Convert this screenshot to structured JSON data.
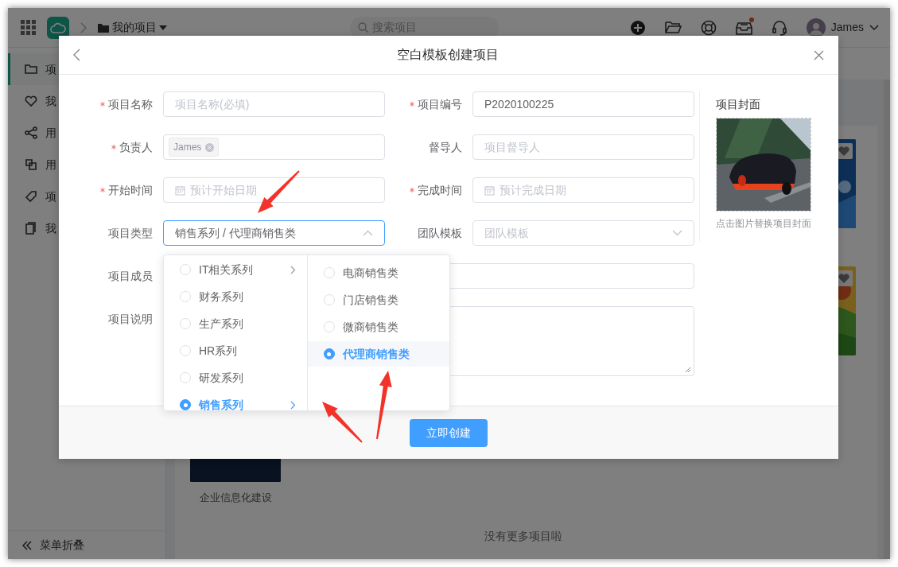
{
  "topbar": {
    "breadcrumb": "我的项目",
    "search": {
      "placeholder": "搜索项目"
    },
    "inbox_unread": true,
    "user": "James"
  },
  "sidebar": {
    "items": [
      {
        "label": "项",
        "selected": true
      },
      {
        "label": "我",
        "selected": false
      },
      {
        "label": "用",
        "selected": false
      },
      {
        "label": "用",
        "selected": false
      },
      {
        "label": "项",
        "selected": false
      },
      {
        "label": "我",
        "selected": false
      }
    ],
    "collapse_label": "菜单折叠"
  },
  "projects": {
    "cards": [
      {
        "kind": "picture",
        "title": "企业信息化建设"
      },
      {
        "kind": "picture",
        "favorite_icon": true
      },
      {
        "kind": "picture",
        "favorite_icon": true
      }
    ],
    "end_note": "没有更多项目啦"
  },
  "dialog": {
    "title": "空白模板创建项目",
    "fields": [
      {
        "label": "项目名称",
        "required": true,
        "kind": "text",
        "placeholder": "项目名称(必填)"
      },
      {
        "label": "项目编号",
        "required": true,
        "kind": "text",
        "value": "P2020100225"
      },
      {
        "label": "负责人",
        "required": true,
        "kind": "tags",
        "tags": [
          "James"
        ]
      },
      {
        "label": "督导人",
        "required": false,
        "kind": "text",
        "placeholder": "项目督导人"
      },
      {
        "label": "开始时间",
        "required": true,
        "kind": "date",
        "placeholder": "预计开始日期"
      },
      {
        "label": "完成时间",
        "required": true,
        "kind": "date",
        "placeholder": "预计完成日期"
      },
      {
        "label": "项目类型",
        "required": false,
        "kind": "cascader",
        "value": "销售系列 / 代理商销售类",
        "expanded": true
      },
      {
        "label": "团队模板",
        "required": false,
        "kind": "select",
        "placeholder": "团队模板",
        "expanded": false
      },
      {
        "label": "项目成员",
        "required": false,
        "kind": "text",
        "wide": true
      },
      {
        "label": "项目说明",
        "required": false,
        "kind": "textarea",
        "wide": true
      }
    ],
    "cover": {
      "label": "项目封面",
      "caption": "点击图片替换项目封面"
    },
    "submit": "立即创建"
  },
  "cascader": {
    "columns": [
      {
        "items": [
          {
            "label": "IT相关系列",
            "selected": false,
            "has_children": true
          },
          {
            "label": "财务系列",
            "selected": false,
            "has_children": false
          },
          {
            "label": "生产系列",
            "selected": false,
            "has_children": false
          },
          {
            "label": "HR系列",
            "selected": false,
            "has_children": false
          },
          {
            "label": "研发系列",
            "selected": false,
            "has_children": false
          },
          {
            "label": "销售系列",
            "selected": true,
            "has_children": true
          }
        ]
      },
      {
        "items": [
          {
            "label": "电商销售类",
            "selected": false
          },
          {
            "label": "门店销售类",
            "selected": false
          },
          {
            "label": "微商销售类",
            "selected": false
          },
          {
            "label": "代理商销售类",
            "selected": true
          }
        ]
      }
    ]
  }
}
